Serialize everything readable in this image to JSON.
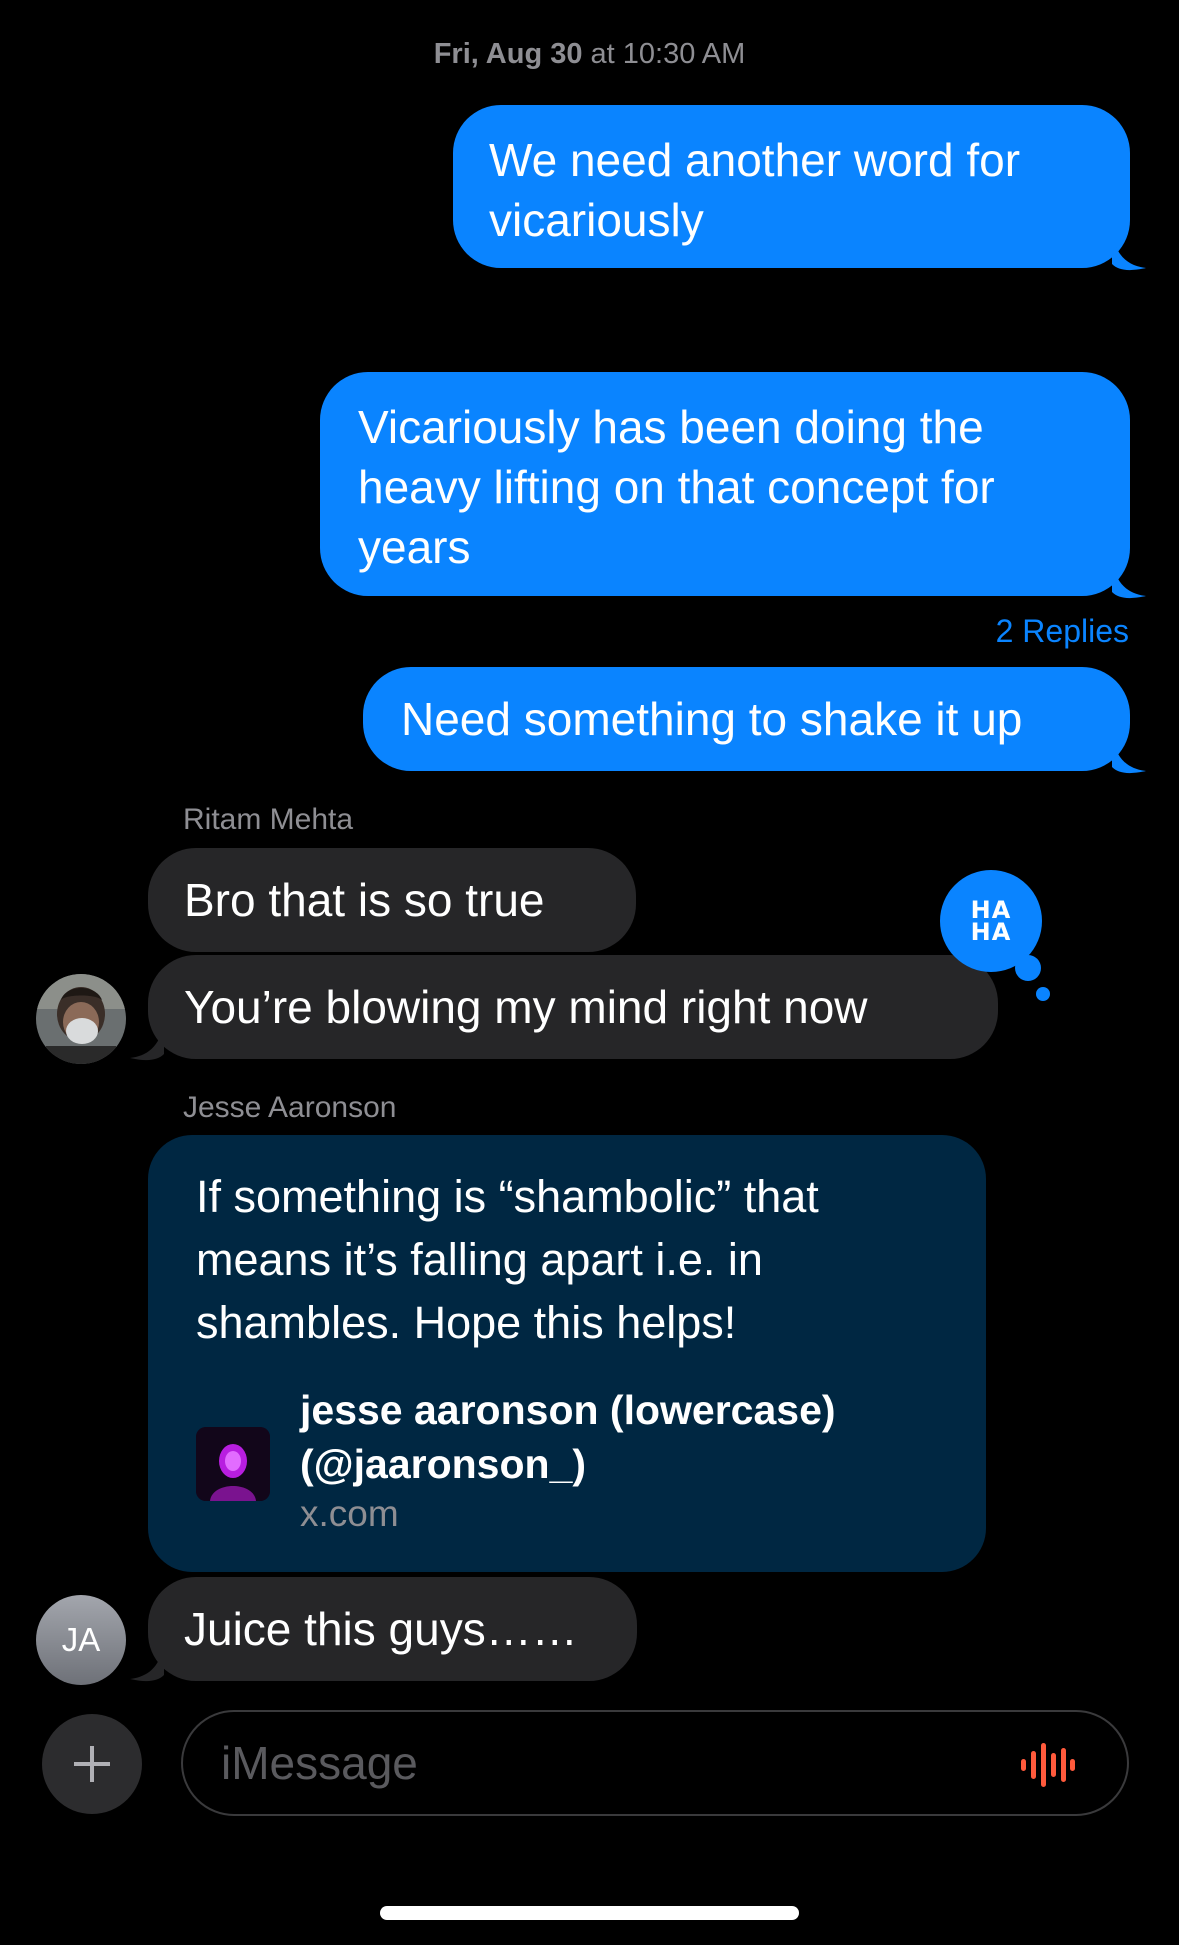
{
  "header": {
    "day": "Fri, Aug 30",
    "time": "at 10:30 AM"
  },
  "messages": {
    "m1": "We need another word for vicariously",
    "m2": "Vicariously has been doing the heavy lifting on that concept for years",
    "m2_replies": "2 Replies",
    "m3": "Need something to shake it up",
    "ritam_name": "Ritam Mehta",
    "r1": "Bro that is so true",
    "r2": "You’re blowing my mind right now",
    "reaction": {
      "line1": "HA",
      "line2": "HA",
      "icon": "haha-tapback-icon"
    },
    "jesse_name": "Jesse Aaronson",
    "j1_text": "If something is “shambolic” that means it’s falling apart i.e. in shambles. Hope this helps!",
    "j1_link_title": "jesse aaronson (lowercase) (@jaaronson_)",
    "j1_link_domain": "x.com",
    "j2": "Juice this guys……"
  },
  "avatars": {
    "jesse_initials": "JA"
  },
  "composer": {
    "placeholder": "iMessage",
    "plus_icon": "plus-icon",
    "mic_icon": "audio-waveform-icon"
  },
  "colors": {
    "outgoing": "#0a84ff",
    "incoming": "#262628",
    "link_card": "#002742",
    "waveform": "#ff5a3c"
  }
}
